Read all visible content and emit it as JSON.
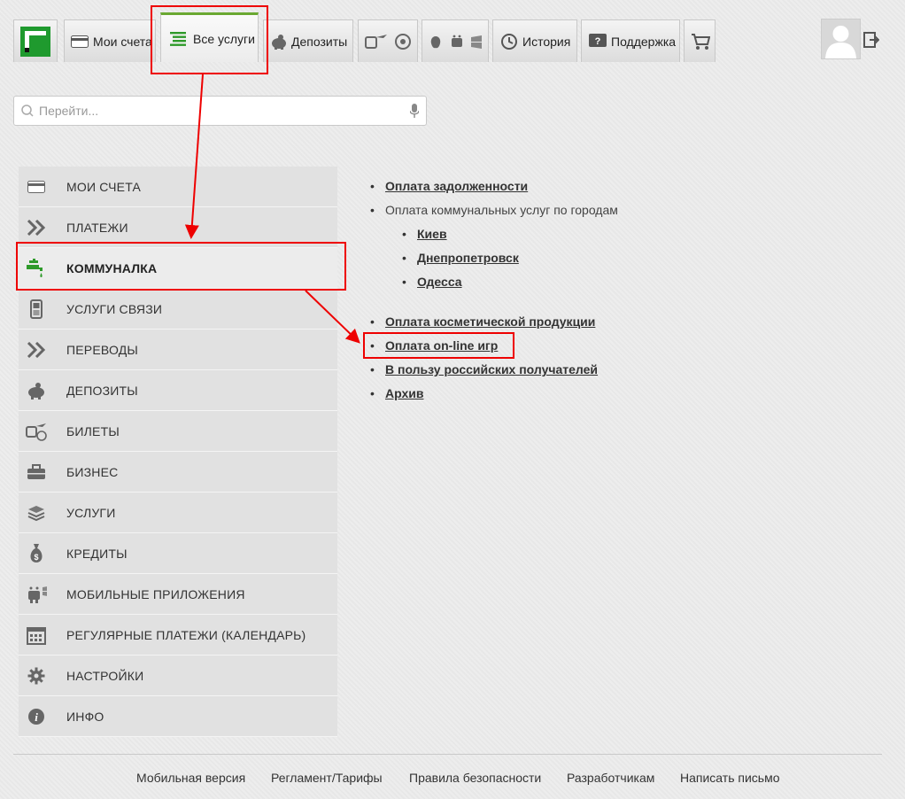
{
  "topbar": {
    "tabs": [
      {
        "label": "Мои счета",
        "icon": "card-icon"
      },
      {
        "label": "Все услуги",
        "icon": "list-icon",
        "active": true
      },
      {
        "label": "Депозиты",
        "icon": "piggy-icon"
      },
      {
        "label": "",
        "icon": "transport-icon"
      },
      {
        "label": "",
        "icon": "mobile-os-icon"
      },
      {
        "label": "История",
        "icon": "history-icon"
      },
      {
        "label": "Поддержка",
        "icon": "support-icon"
      },
      {
        "label": "",
        "icon": "cart-icon"
      }
    ]
  },
  "search": {
    "placeholder": "Перейти..."
  },
  "sidebar": {
    "items": [
      {
        "label": "МОИ СЧЕТА",
        "icon": "card-icon"
      },
      {
        "label": "ПЛАТЕЖИ",
        "icon": "double-chevron-icon"
      },
      {
        "label": "КОММУНАЛКА",
        "icon": "faucet-icon",
        "active": true
      },
      {
        "label": "УСЛУГИ СВЯЗИ",
        "icon": "phone-icon"
      },
      {
        "label": "ПЕРЕВОДЫ",
        "icon": "double-chevron-icon"
      },
      {
        "label": "ДЕПОЗИТЫ",
        "icon": "piggy-icon"
      },
      {
        "label": "БИЛЕТЫ",
        "icon": "tickets-icon"
      },
      {
        "label": "БИЗНЕС",
        "icon": "briefcase-icon"
      },
      {
        "label": "УСЛУГИ",
        "icon": "box-icon"
      },
      {
        "label": "КРЕДИТЫ",
        "icon": "moneybag-icon"
      },
      {
        "label": "МОБИЛЬНЫЕ ПРИЛОЖЕНИЯ",
        "icon": "mobile-apps-icon"
      },
      {
        "label": "РЕГУЛЯРНЫЕ ПЛАТЕЖИ (КАЛЕНДАРЬ)",
        "icon": "calendar-icon"
      },
      {
        "label": "НАСТРОЙКИ",
        "icon": "gear-icon"
      },
      {
        "label": "ИНФО",
        "icon": "info-icon"
      }
    ]
  },
  "content": {
    "debt": "Оплата задолженности",
    "cities_heading": "Оплата коммунальных услуг по городам",
    "cities": [
      "Киев",
      "Днепропетровск",
      "Одесса"
    ],
    "cosmetics": "Оплата косметической продукции",
    "online_games": "Оплата on-line игр",
    "russian": "В пользу российских получателей",
    "archive": "Архив"
  },
  "footer": {
    "links": [
      "Мобильная версия",
      "Регламент/Тарифы",
      "Правила безопасности",
      "Разработчикам",
      "Написать письмо"
    ]
  },
  "colors": {
    "accent": "#6aa832",
    "annotation": "#e00000",
    "logo_green": "#1f9a2e"
  }
}
